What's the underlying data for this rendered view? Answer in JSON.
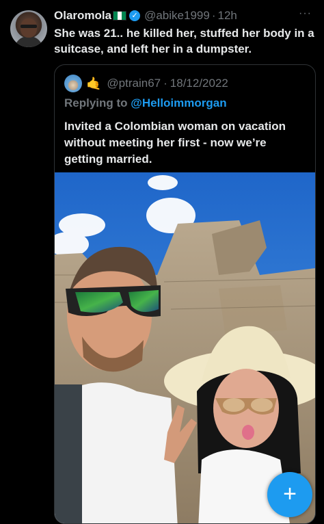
{
  "tweet": {
    "author_name": "Olaromola",
    "author_flag": "nigeria-flag-icon",
    "handle": "@abike1999",
    "separator": "·",
    "time": "12h",
    "more_glyph": "···",
    "text": "She was 21.. he killed her, stuffed her body in a suitcase, and left her in a dumpster."
  },
  "quoted": {
    "emoji": "🤙",
    "handle": "@ptrain67",
    "separator": "·",
    "date": "18/12/2022",
    "replying_prefix": "Replying to",
    "replying_to": "@Helloimmorgan",
    "text": "Invited a Colombian woman on vacation without meeting her first - now we’re getting married."
  },
  "compose": {
    "glyph": "+"
  },
  "colors": {
    "accent": "#1d9bf0",
    "background": "#000000",
    "muted": "#71767b",
    "text": "#e7e9ea"
  }
}
